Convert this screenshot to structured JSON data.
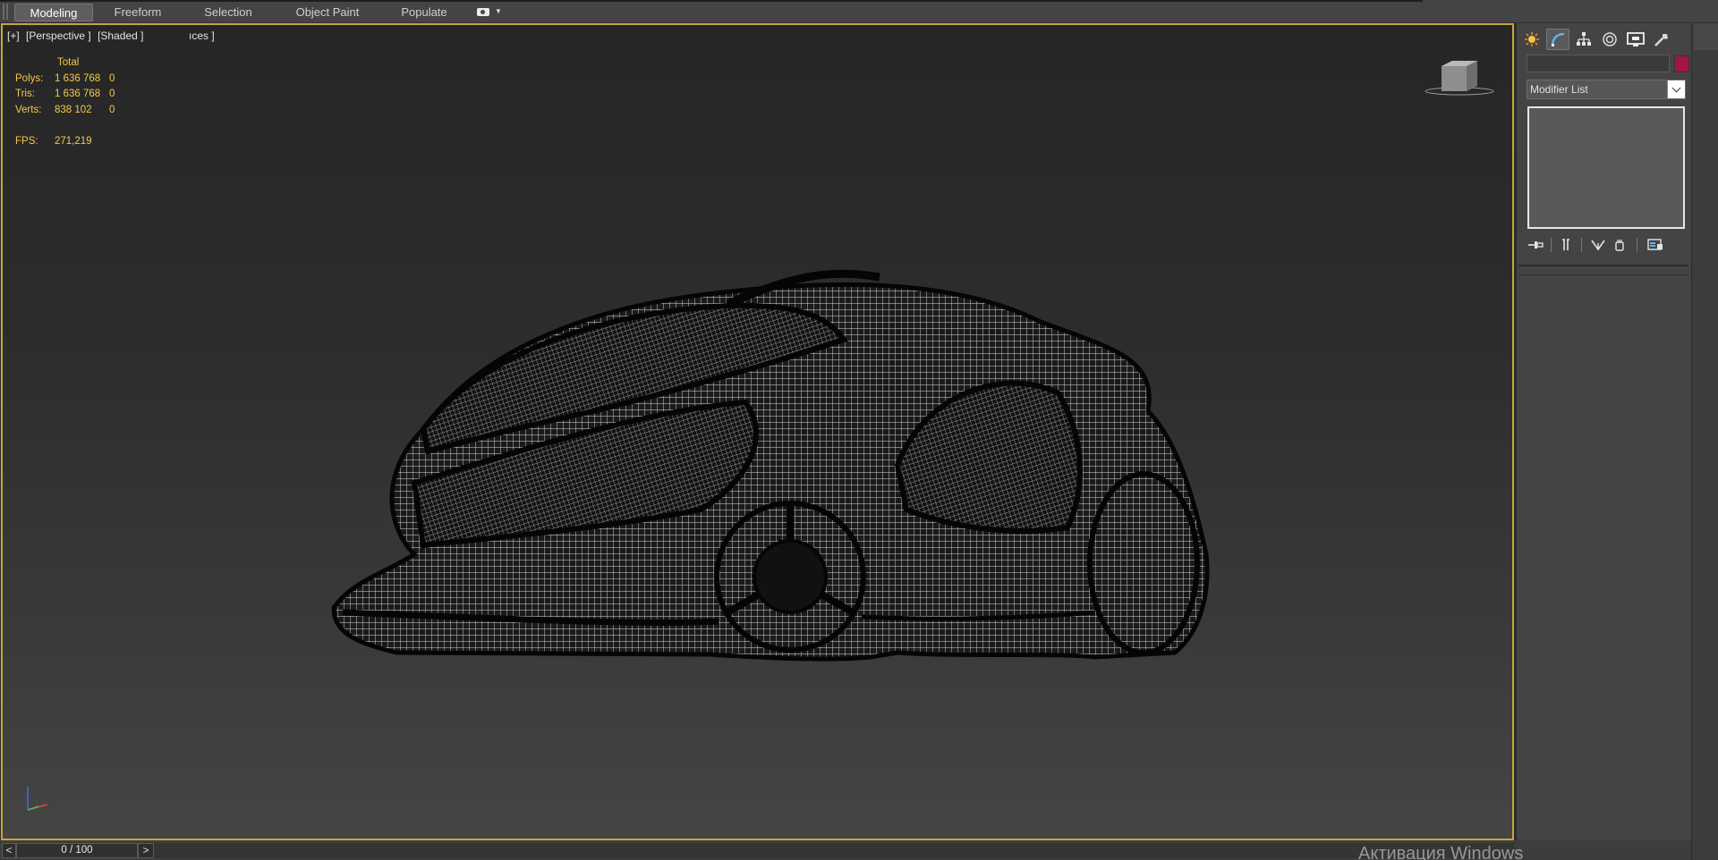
{
  "ribbon": {
    "tabs": [
      {
        "label": "Modeling",
        "active": true
      },
      {
        "label": "Freeform",
        "active": false
      },
      {
        "label": "Selection",
        "active": false
      },
      {
        "label": "Object Paint",
        "active": false
      },
      {
        "label": "Populate",
        "active": false
      }
    ],
    "more_icon": "camera-dropdown-icon"
  },
  "viewport": {
    "label_plus": "[+]",
    "label_view": "[Perspective ]",
    "label_shading": "[Shaded ]",
    "label_extra": "ıces ]",
    "stats": {
      "header": "Total",
      "rows": [
        {
          "key": "Polys:",
          "value": "1 636 768",
          "selected": "0"
        },
        {
          "key": "Tris:",
          "value": "1 636 768",
          "selected": "0"
        },
        {
          "key": "Verts:",
          "value": "838 102",
          "selected": "0"
        }
      ],
      "fps_key": "FPS:",
      "fps_value": "271,219"
    },
    "viewcube_icon": "viewcube-icon",
    "tripod_icon": "axis-tripod-icon",
    "model_icon": "wireframe-car-model",
    "border_color": "#c8a53a"
  },
  "command_panel": {
    "tabs": [
      "create-icon",
      "modify-icon",
      "hierarchy-icon",
      "motion-icon",
      "display-icon",
      "utilities-icon"
    ],
    "active_tab": 1,
    "name_value": "",
    "object_color": "#a3154a",
    "modifier_list_label": "Modifier List",
    "stack_tools": [
      "pin-stack-icon",
      "show-end-result-icon",
      "make-unique-icon",
      "remove-modifier-icon",
      "configure-sets-icon"
    ]
  },
  "time_slider": {
    "prev": "<",
    "frame": "0 / 100",
    "next": ">"
  },
  "watermark": "Активация Windows"
}
